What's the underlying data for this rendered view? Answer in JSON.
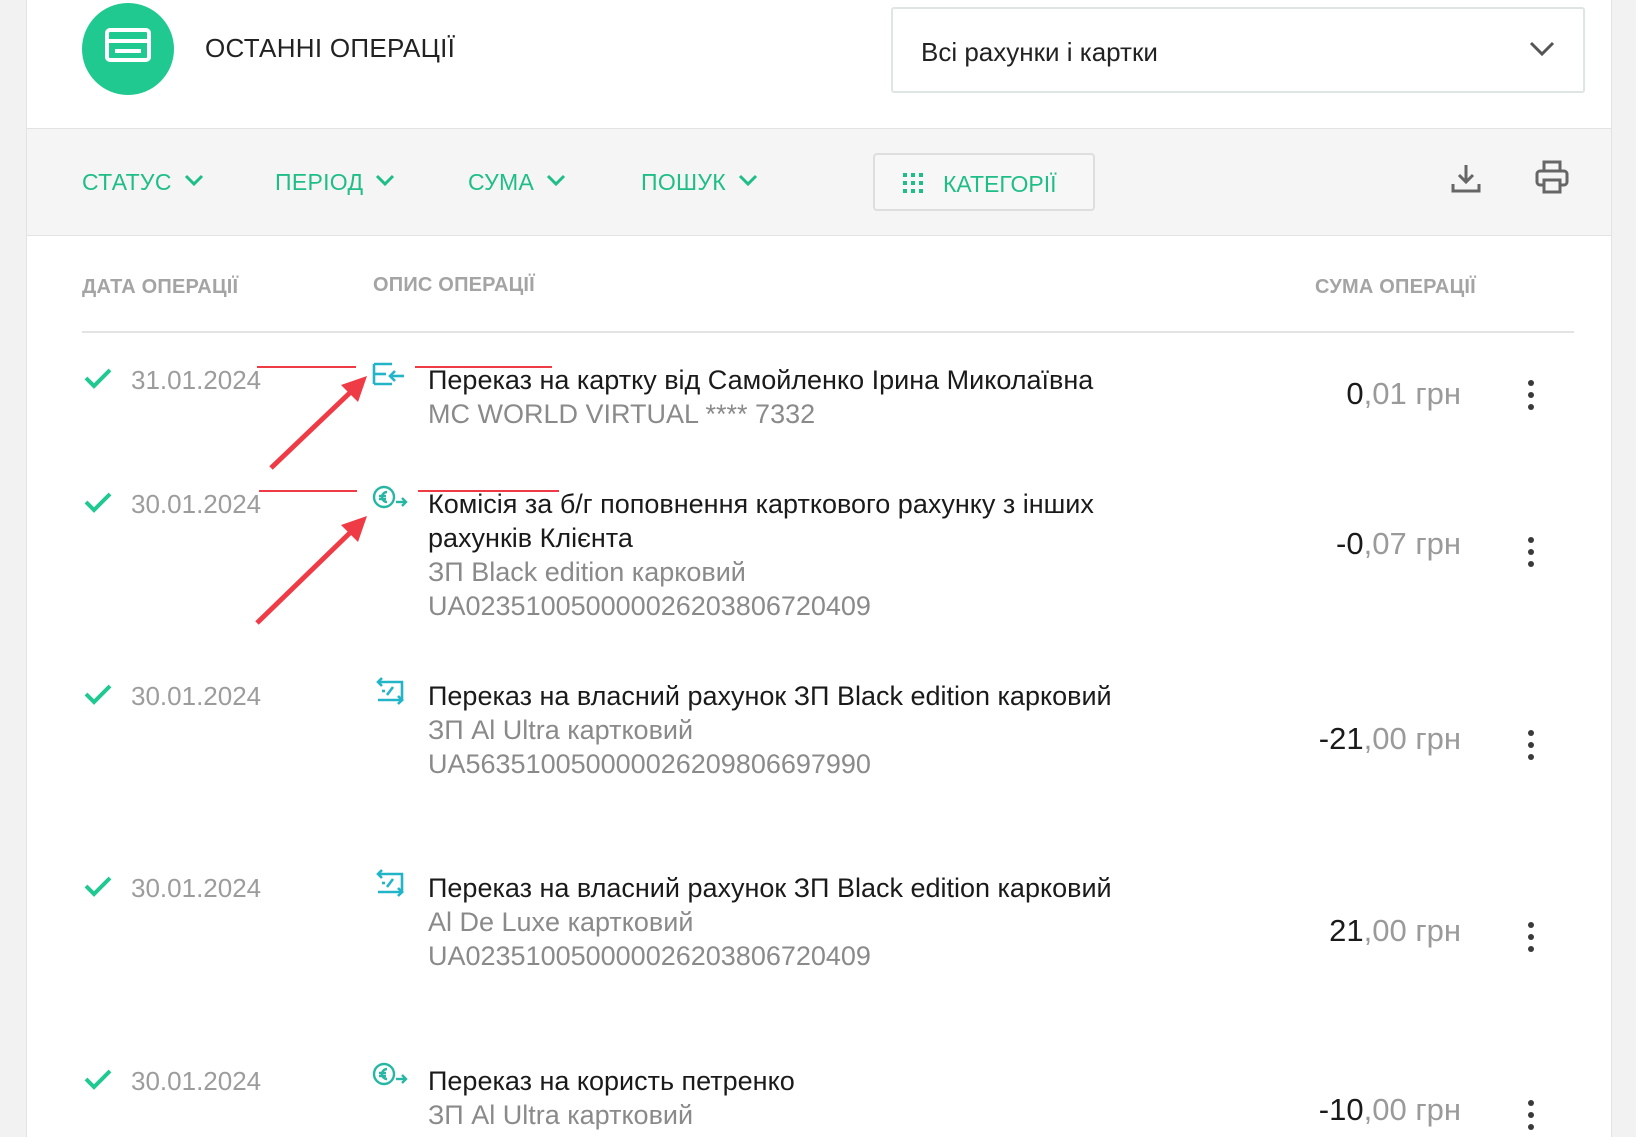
{
  "header": {
    "title": "ОСТАННІ ОПЕРАЦІЇ",
    "logo_icon": "statement-icon",
    "account_select": {
      "value": "Всі рахунки і картки"
    }
  },
  "filters": {
    "status": "СТАТУС",
    "period": "ПЕРІОД",
    "amount": "СУМА",
    "search": "ПОШУК",
    "categories": "КАТЕГОРІЇ"
  },
  "columns": {
    "date": "ДАТА ОПЕРАЦІЇ",
    "description": "ОПИС ОПЕРАЦІЇ",
    "amount": "СУМА ОПЕРАЦІЇ"
  },
  "colors": {
    "accent": "#1fc98f",
    "accent_text": "#1fbe87",
    "icon_teal": "#22b5c8",
    "annotation_red": "#ef3b46"
  },
  "transactions": [
    {
      "status": "completed",
      "date": "31.01.2024",
      "icon": "incoming-transfer-icon",
      "title": "Переказ на картку від Самойленко Ірина Миколаївна",
      "account": "MC WORLD VIRTUAL **** 7332",
      "iban": "",
      "amount_int": "0",
      "amount_dec": ",01",
      "currency": "грн"
    },
    {
      "status": "completed",
      "date": "30.01.2024",
      "icon": "commission-payment-icon",
      "title": "Комісія за б/г поповнення карткового рахунку з інших рахунків Клієнта",
      "account": "ЗП Black edition карковий",
      "iban": "UA023510050000026203806720409",
      "amount_int": "-0",
      "amount_dec": ",07",
      "currency": "грн"
    },
    {
      "status": "completed",
      "date": "30.01.2024",
      "icon": "own-account-transfer-icon",
      "title": "Переказ на власний рахунок ЗП Black edition карковий",
      "account": "ЗП Al Ultra картковий",
      "iban": "UA563510050000026209806697990",
      "amount_int": "-21",
      "amount_dec": ",00",
      "currency": "грн"
    },
    {
      "status": "completed",
      "date": "30.01.2024",
      "icon": "own-account-transfer-icon",
      "title": "Переказ на власний рахунок ЗП Black edition карковий",
      "account": "Al De Luxe картковий",
      "iban": "UA023510050000026203806720409",
      "amount_int": "21",
      "amount_dec": ",00",
      "currency": "грн"
    },
    {
      "status": "completed",
      "date": "30.01.2024",
      "icon": "commission-payment-icon",
      "title": "Переказ на користь петренко",
      "account": "ЗП Al Ultra картковий",
      "iban": "",
      "amount_int": "-10",
      "amount_dec": ",00",
      "currency": "грн"
    }
  ]
}
